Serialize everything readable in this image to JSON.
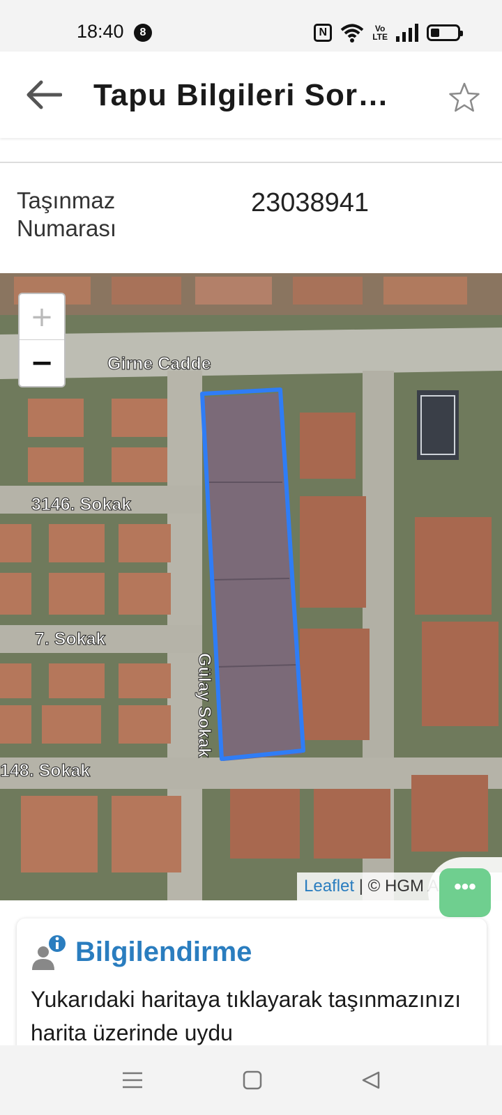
{
  "status_bar": {
    "time": "18:40",
    "notification_count": "8",
    "nfc_label": "N",
    "volte_top": "Vo",
    "volte_bottom": "LTE"
  },
  "header": {
    "title": "Tapu Bilgileri Sor…",
    "back_icon": "arrow-left-icon",
    "favorite_icon": "star-outline-icon"
  },
  "property": {
    "label": "Taşınmaz Numarası",
    "number": "23038941"
  },
  "map": {
    "street_labels": {
      "girne": "Girne Cadde",
      "s3146": "3146. Sokak",
      "s7": "7. Sokak",
      "s148": "148. Sokak",
      "gulay": "Gülay Sokak"
    },
    "zoom_in": "+",
    "zoom_out": "−",
    "attribution_link": "Leaflet",
    "attribution_rest": " | © HGM Atlas",
    "parcel_color": "#2f7df6"
  },
  "chat_fab": {
    "label": "•••",
    "icon": "chat-icon"
  },
  "info_card": {
    "title": "Bilgilendirme",
    "text": "Yukarıdaki haritaya tıklayarak taşınmazınızı harita üzerinde uydu",
    "icon": "user-info-icon"
  },
  "nav_bar": {
    "recents_icon": "menu-lines-icon",
    "home_icon": "square-home-icon",
    "back_icon": "triangle-back-icon"
  }
}
